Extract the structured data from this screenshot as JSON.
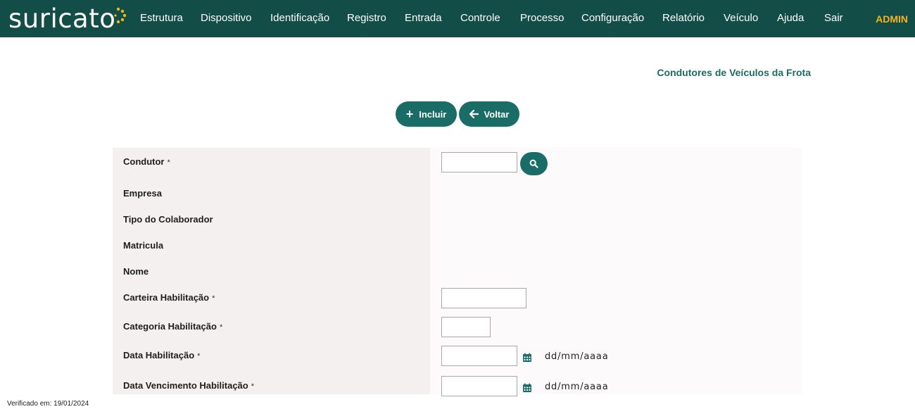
{
  "logo": {
    "text": "suricato",
    "dot_color": "#f6b21b"
  },
  "menu": [
    {
      "label": "Estrutura",
      "name": "menu-item-estrutura"
    },
    {
      "label": "Dispositivo",
      "name": "menu-item-dispositivo"
    },
    {
      "label": "Identificação",
      "name": "menu-item-identificacao"
    },
    {
      "label": "Registro",
      "name": "menu-item-registro"
    },
    {
      "label": "Entrada",
      "name": "menu-item-entrada"
    },
    {
      "label": "Controle",
      "name": "menu-item-controle"
    },
    {
      "label": "Processo",
      "name": "menu-item-processo"
    },
    {
      "label": "Configuração",
      "name": "menu-item-configuracao"
    },
    {
      "label": "Relatório",
      "name": "menu-item-relatorio"
    },
    {
      "label": "Veículo",
      "name": "menu-item-veiculo"
    },
    {
      "label": "Ajuda",
      "name": "menu-item-ajuda"
    },
    {
      "label": "Sair",
      "name": "menu-item-sair"
    }
  ],
  "user": "ADMIN",
  "page": {
    "title": "Condutores de Veículos da Frota"
  },
  "actions": {
    "incluir": "Incluir",
    "voltar": "Voltar"
  },
  "form": {
    "required_mark": "*",
    "condutor": {
      "label": "Condutor",
      "value": ""
    },
    "empresa": {
      "label": "Empresa"
    },
    "tipo_colaborador": {
      "label": "Tipo do Colaborador"
    },
    "matricula": {
      "label": "Matricula"
    },
    "nome": {
      "label": "Nome"
    },
    "carteira": {
      "label": "Carteira Habilitação",
      "value": ""
    },
    "categoria": {
      "label": "Categoria Habilitação",
      "value": ""
    },
    "data_habilitacao": {
      "label": "Data Habilitação",
      "value": "",
      "format_hint": "dd/mm/aaaa"
    },
    "data_vencimento": {
      "label": "Data Vencimento Habilitação",
      "value": "",
      "format_hint": "dd/mm/aaaa"
    }
  },
  "footer": {
    "verified": "Verificado em: 19/01/2024"
  },
  "colors": {
    "topbar": "#134d47",
    "button": "#1a6d66",
    "title": "#1c6b63",
    "admin": "#f6b21b"
  }
}
